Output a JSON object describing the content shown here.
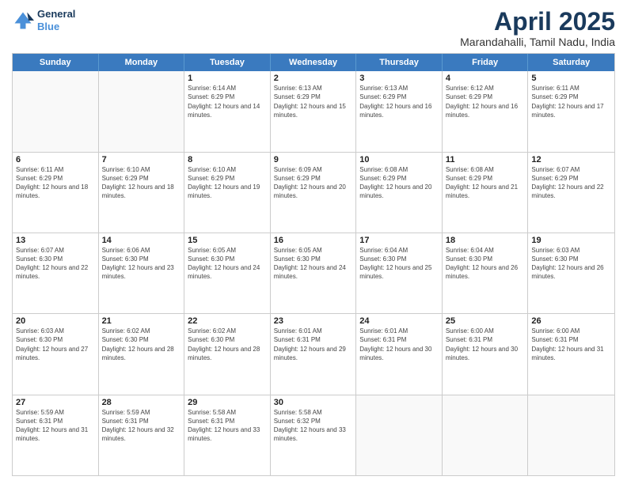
{
  "header": {
    "logo_line1": "General",
    "logo_line2": "Blue",
    "title": "April 2025",
    "subtitle": "Marandahalli, Tamil Nadu, India"
  },
  "days_of_week": [
    "Sunday",
    "Monday",
    "Tuesday",
    "Wednesday",
    "Thursday",
    "Friday",
    "Saturday"
  ],
  "weeks": [
    [
      {
        "day": "",
        "empty": true
      },
      {
        "day": "",
        "empty": true
      },
      {
        "day": "1",
        "sunrise": "6:14 AM",
        "sunset": "6:29 PM",
        "daylight": "12 hours and 14 minutes."
      },
      {
        "day": "2",
        "sunrise": "6:13 AM",
        "sunset": "6:29 PM",
        "daylight": "12 hours and 15 minutes."
      },
      {
        "day": "3",
        "sunrise": "6:13 AM",
        "sunset": "6:29 PM",
        "daylight": "12 hours and 16 minutes."
      },
      {
        "day": "4",
        "sunrise": "6:12 AM",
        "sunset": "6:29 PM",
        "daylight": "12 hours and 16 minutes."
      },
      {
        "day": "5",
        "sunrise": "6:11 AM",
        "sunset": "6:29 PM",
        "daylight": "12 hours and 17 minutes."
      }
    ],
    [
      {
        "day": "6",
        "sunrise": "6:11 AM",
        "sunset": "6:29 PM",
        "daylight": "12 hours and 18 minutes."
      },
      {
        "day": "7",
        "sunrise": "6:10 AM",
        "sunset": "6:29 PM",
        "daylight": "12 hours and 18 minutes."
      },
      {
        "day": "8",
        "sunrise": "6:10 AM",
        "sunset": "6:29 PM",
        "daylight": "12 hours and 19 minutes."
      },
      {
        "day": "9",
        "sunrise": "6:09 AM",
        "sunset": "6:29 PM",
        "daylight": "12 hours and 20 minutes."
      },
      {
        "day": "10",
        "sunrise": "6:08 AM",
        "sunset": "6:29 PM",
        "daylight": "12 hours and 20 minutes."
      },
      {
        "day": "11",
        "sunrise": "6:08 AM",
        "sunset": "6:29 PM",
        "daylight": "12 hours and 21 minutes."
      },
      {
        "day": "12",
        "sunrise": "6:07 AM",
        "sunset": "6:29 PM",
        "daylight": "12 hours and 22 minutes."
      }
    ],
    [
      {
        "day": "13",
        "sunrise": "6:07 AM",
        "sunset": "6:30 PM",
        "daylight": "12 hours and 22 minutes."
      },
      {
        "day": "14",
        "sunrise": "6:06 AM",
        "sunset": "6:30 PM",
        "daylight": "12 hours and 23 minutes."
      },
      {
        "day": "15",
        "sunrise": "6:05 AM",
        "sunset": "6:30 PM",
        "daylight": "12 hours and 24 minutes."
      },
      {
        "day": "16",
        "sunrise": "6:05 AM",
        "sunset": "6:30 PM",
        "daylight": "12 hours and 24 minutes."
      },
      {
        "day": "17",
        "sunrise": "6:04 AM",
        "sunset": "6:30 PM",
        "daylight": "12 hours and 25 minutes."
      },
      {
        "day": "18",
        "sunrise": "6:04 AM",
        "sunset": "6:30 PM",
        "daylight": "12 hours and 26 minutes."
      },
      {
        "day": "19",
        "sunrise": "6:03 AM",
        "sunset": "6:30 PM",
        "daylight": "12 hours and 26 minutes."
      }
    ],
    [
      {
        "day": "20",
        "sunrise": "6:03 AM",
        "sunset": "6:30 PM",
        "daylight": "12 hours and 27 minutes."
      },
      {
        "day": "21",
        "sunrise": "6:02 AM",
        "sunset": "6:30 PM",
        "daylight": "12 hours and 28 minutes."
      },
      {
        "day": "22",
        "sunrise": "6:02 AM",
        "sunset": "6:30 PM",
        "daylight": "12 hours and 28 minutes."
      },
      {
        "day": "23",
        "sunrise": "6:01 AM",
        "sunset": "6:31 PM",
        "daylight": "12 hours and 29 minutes."
      },
      {
        "day": "24",
        "sunrise": "6:01 AM",
        "sunset": "6:31 PM",
        "daylight": "12 hours and 30 minutes."
      },
      {
        "day": "25",
        "sunrise": "6:00 AM",
        "sunset": "6:31 PM",
        "daylight": "12 hours and 30 minutes."
      },
      {
        "day": "26",
        "sunrise": "6:00 AM",
        "sunset": "6:31 PM",
        "daylight": "12 hours and 31 minutes."
      }
    ],
    [
      {
        "day": "27",
        "sunrise": "5:59 AM",
        "sunset": "6:31 PM",
        "daylight": "12 hours and 31 minutes."
      },
      {
        "day": "28",
        "sunrise": "5:59 AM",
        "sunset": "6:31 PM",
        "daylight": "12 hours and 32 minutes."
      },
      {
        "day": "29",
        "sunrise": "5:58 AM",
        "sunset": "6:31 PM",
        "daylight": "12 hours and 33 minutes."
      },
      {
        "day": "30",
        "sunrise": "5:58 AM",
        "sunset": "6:32 PM",
        "daylight": "12 hours and 33 minutes."
      },
      {
        "day": "",
        "empty": true
      },
      {
        "day": "",
        "empty": true
      },
      {
        "day": "",
        "empty": true
      }
    ]
  ]
}
